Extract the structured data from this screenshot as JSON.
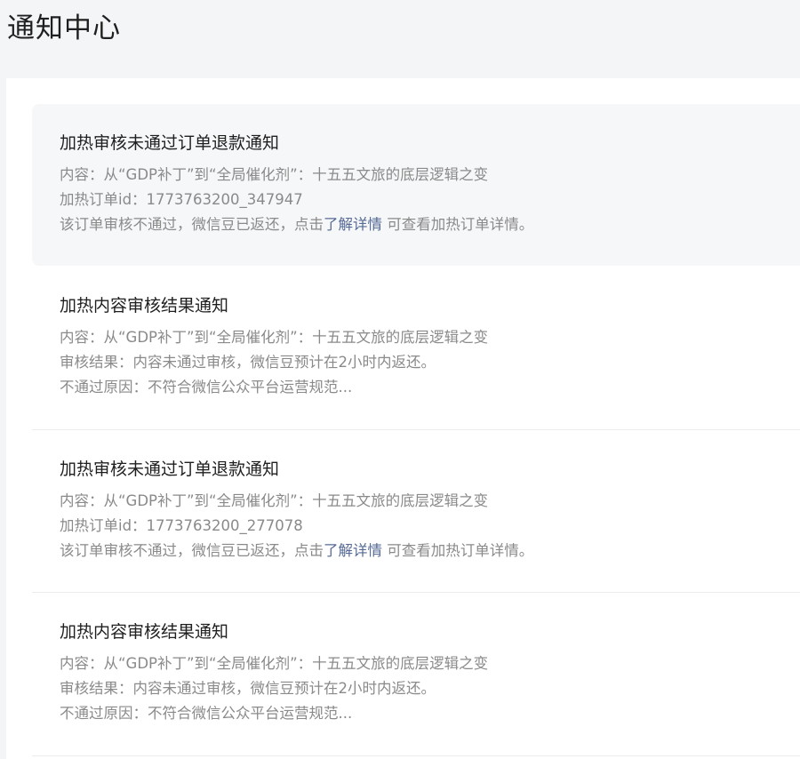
{
  "page": {
    "title": "通知中心"
  },
  "notices": [
    {
      "title": "加热审核未通过订单退款通知",
      "content": "内容：从“GDP补丁”到“全局催化剂”：十五五文旅的底层逻辑之变",
      "line2": "加热订单id：1773763200_347947",
      "line3_prefix": "该订单审核不通过，微信豆已返还，点击",
      "link": "了解详情",
      "line3_suffix": " 可查看加热订单详情。"
    },
    {
      "title": "加热内容审核结果通知",
      "content": "内容：从“GDP补丁”到“全局催化剂”：十五五文旅的底层逻辑之变",
      "line2": "审核结果：内容未通过审核，微信豆预计在2小时内返还。",
      "line3": "不通过原因：不符合微信公众平台运营规范..."
    },
    {
      "title": "加热审核未通过订单退款通知",
      "content": "内容：从“GDP补丁”到“全局催化剂”：十五五文旅的底层逻辑之变",
      "line2": "加热订单id：1773763200_277078",
      "line3_prefix": "该订单审核不通过，微信豆已返还，点击",
      "link": "了解详情",
      "line3_suffix": " 可查看加热订单详情。"
    },
    {
      "title": "加热内容审核结果通知",
      "content": "内容：从“GDP补丁”到“全局催化剂”：十五五文旅的底层逻辑之变",
      "line2": "审核结果：内容未通过审核，微信豆预计在2小时内返还。",
      "line3": "不通过原因：不符合微信公众平台运营规范..."
    }
  ]
}
